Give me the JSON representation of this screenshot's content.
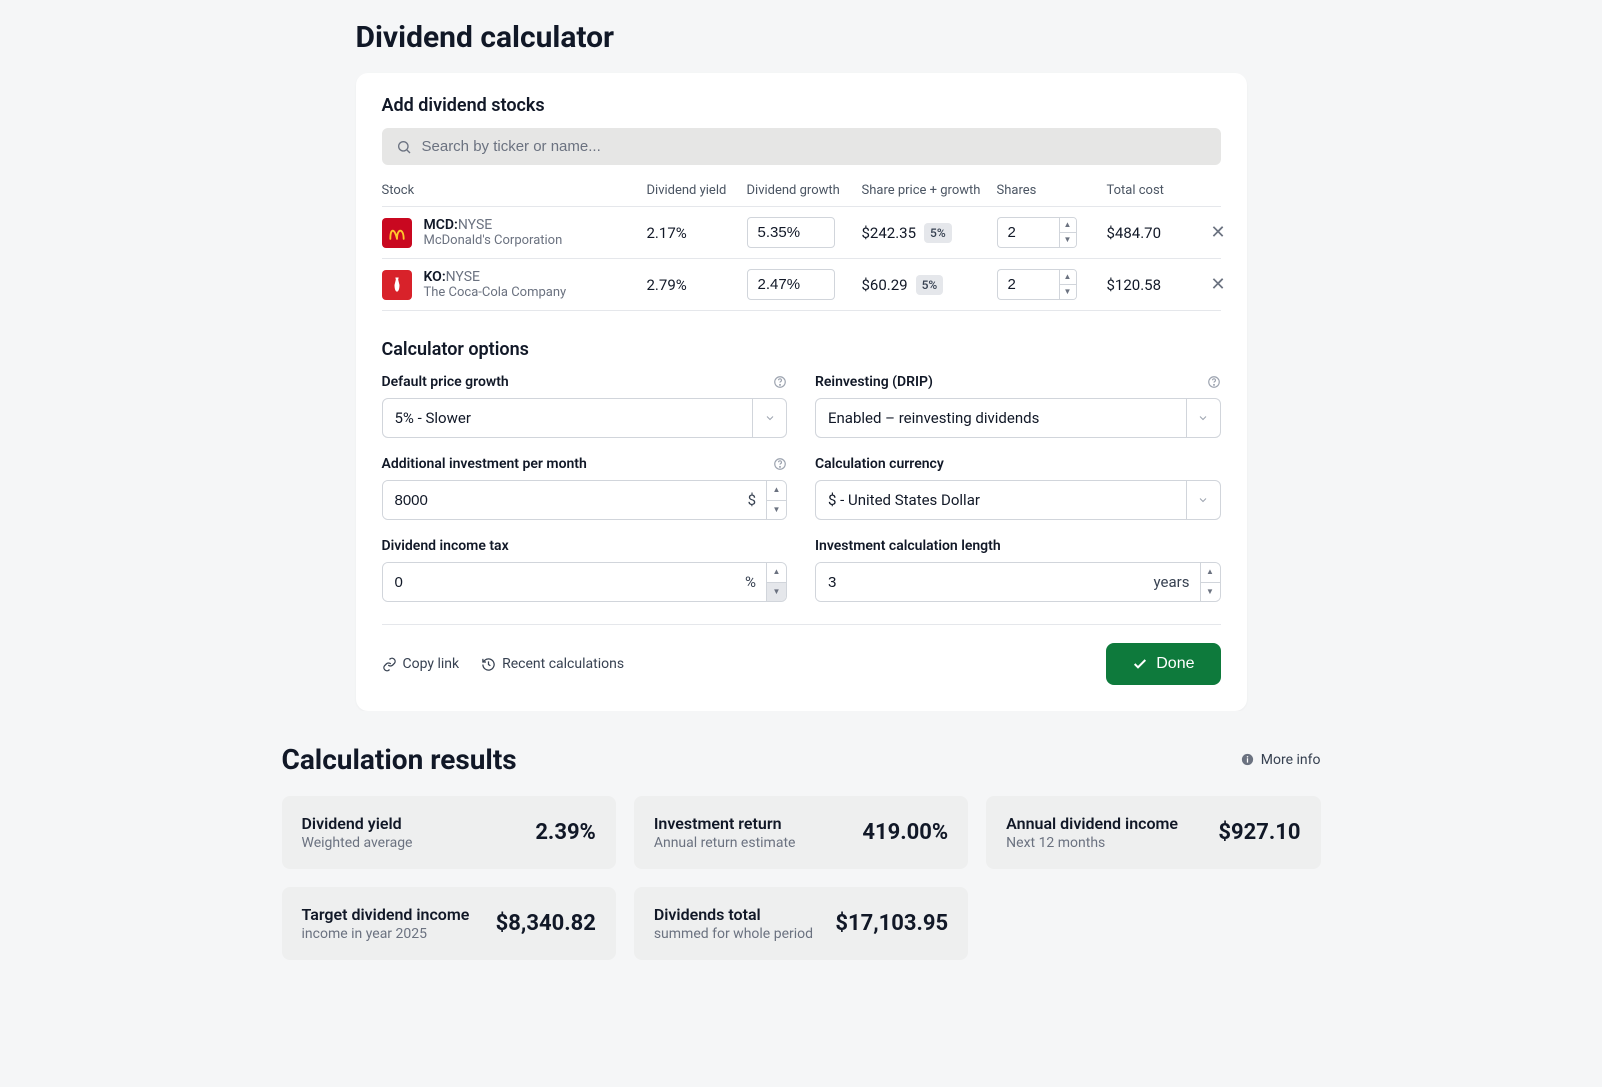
{
  "page_title": "Dividend calculator",
  "add_section_title": "Add dividend stocks",
  "search_placeholder": "Search by ticker or name...",
  "columns": {
    "stock": "Stock",
    "dividend_yield": "Dividend yield",
    "dividend_growth": "Dividend growth",
    "share_price_growth": "Share price + growth",
    "shares": "Shares",
    "total_cost": "Total cost"
  },
  "rows": [
    {
      "ticker": "MCD:",
      "exchange": "NYSE",
      "company": "McDonald's Corporation",
      "dividend_yield": "2.17%",
      "dividend_growth": "5.35%",
      "share_price": "$242.35",
      "growth_badge": "5%",
      "shares": "2",
      "total_cost": "$484.70",
      "logo_color": "#c90820",
      "logo": "arches"
    },
    {
      "ticker": "KO:",
      "exchange": "NYSE",
      "company": "The Coca-Cola Company",
      "dividend_yield": "2.79%",
      "dividend_growth": "2.47%",
      "share_price": "$60.29",
      "growth_badge": "5%",
      "shares": "2",
      "total_cost": "$120.58",
      "logo_color": "#d8222a",
      "logo": "bottle"
    }
  ],
  "options_title": "Calculator options",
  "options": {
    "default_price_growth_label": "Default price growth",
    "default_price_growth_value": "5% - Slower",
    "reinvesting_label": "Reinvesting (DRIP)",
    "reinvesting_value": "Enabled – reinvesting dividends",
    "additional_investment_label": "Additional investment per month",
    "additional_investment_value": "8000",
    "additional_investment_unit": "$",
    "calc_currency_label": "Calculation currency",
    "calc_currency_value": "$ - United States Dollar",
    "dividend_tax_label": "Dividend income tax",
    "dividend_tax_value": "0",
    "dividend_tax_unit": "%",
    "calc_length_label": "Investment calculation length",
    "calc_length_value": "3",
    "calc_length_unit": "years"
  },
  "footer": {
    "copy_link": "Copy link",
    "recent_calcs": "Recent calculations",
    "done": "Done"
  },
  "results": {
    "title": "Calculation results",
    "more_info": "More info",
    "cards": [
      {
        "title": "Dividend yield",
        "sub": "Weighted average",
        "value": "2.39%"
      },
      {
        "title": "Investment return",
        "sub": "Annual return estimate",
        "value": "419.00%"
      },
      {
        "title": "Annual dividend income",
        "sub": "Next 12 months",
        "value": "$927.10"
      },
      {
        "title": "Target dividend income",
        "sub": "income in year 2025",
        "value": "$8,340.82"
      },
      {
        "title": "Dividends total",
        "sub": "summed for whole period",
        "value": "$17,103.95"
      }
    ]
  }
}
